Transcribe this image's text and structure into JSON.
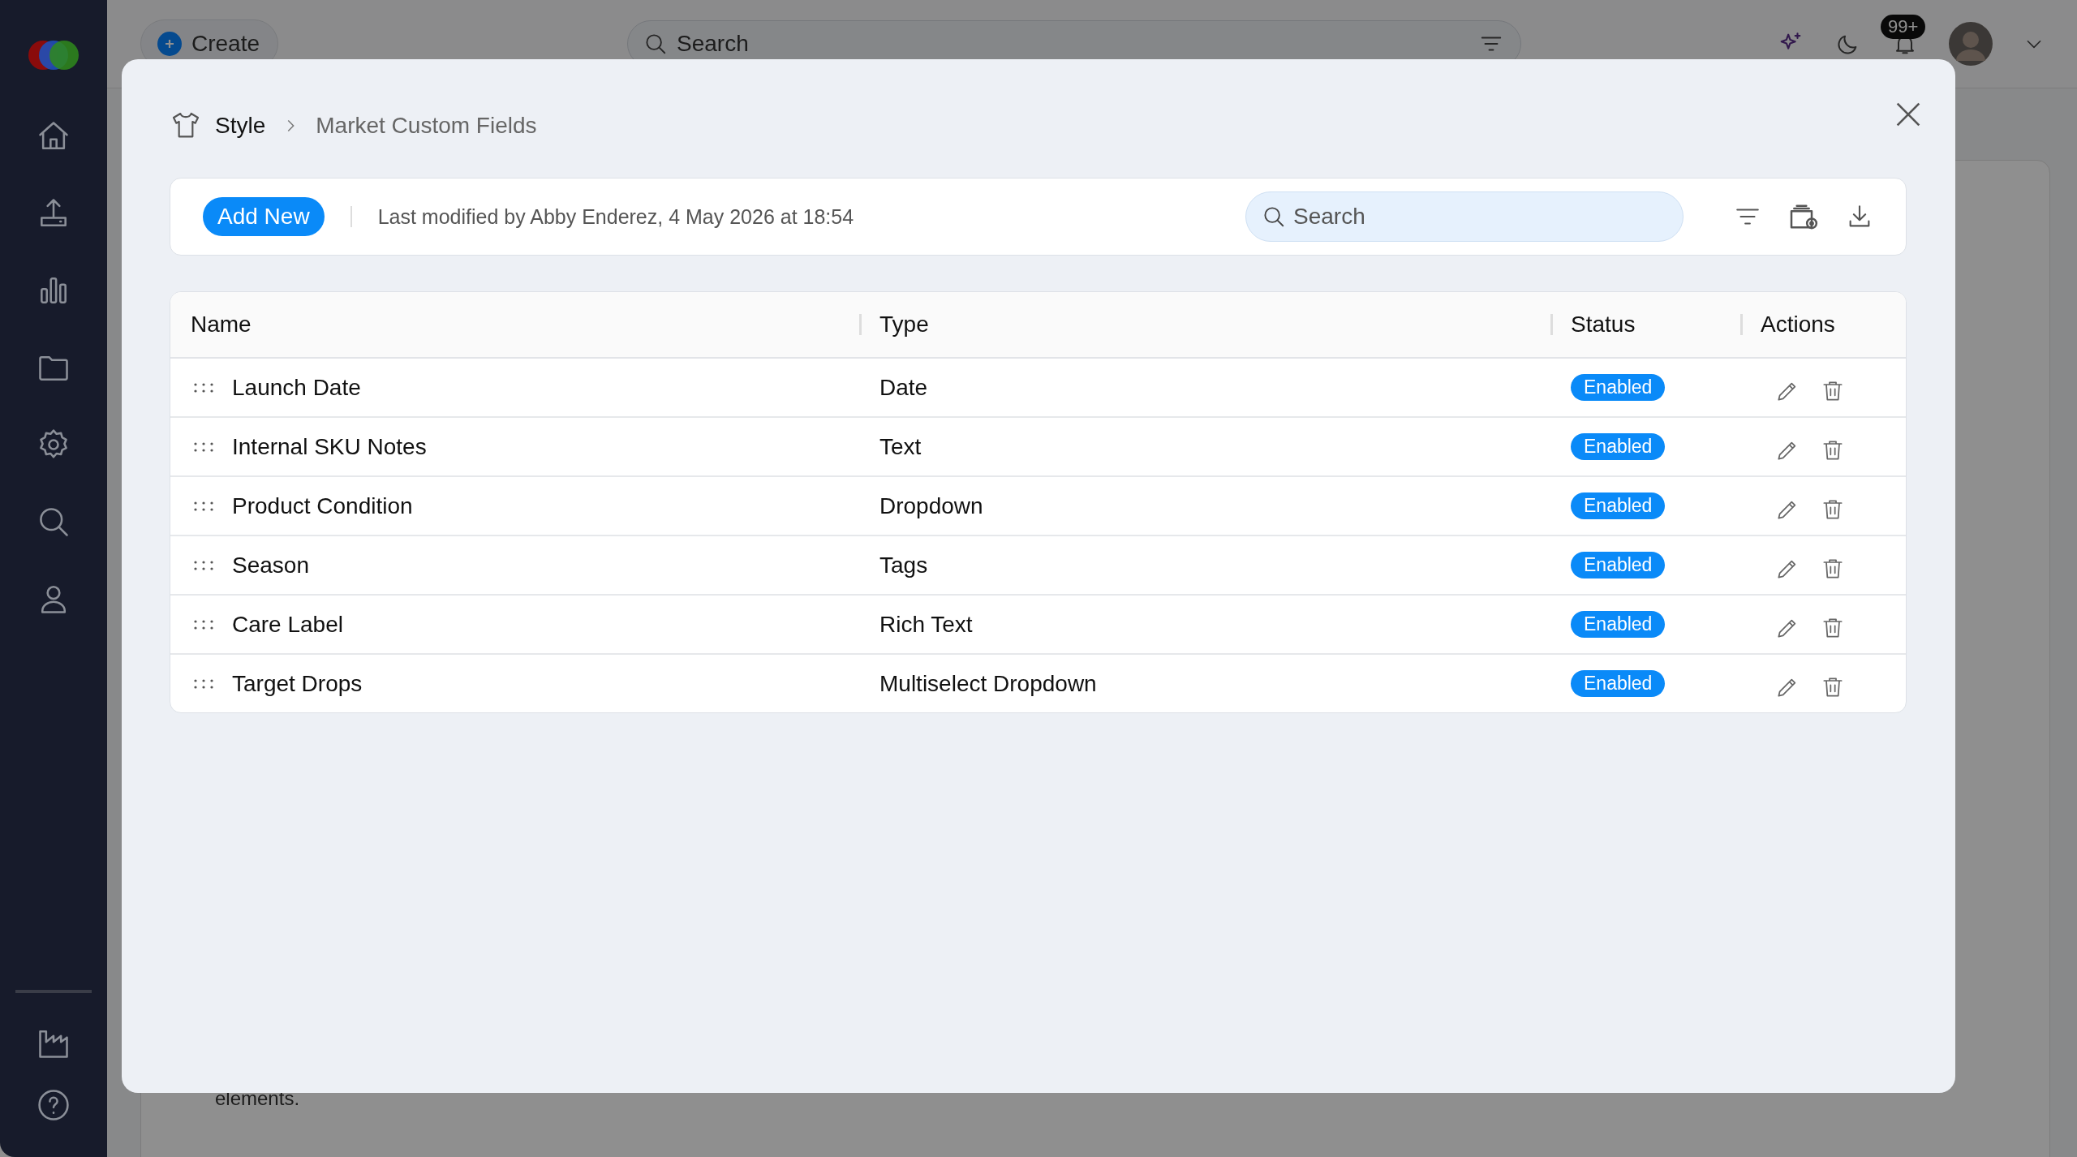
{
  "app": {
    "create_button": "Create",
    "search": {
      "placeholder": "Search"
    },
    "notifications_badge": "99+",
    "background_text": "elements."
  },
  "modal": {
    "breadcrumb": [
      "Style",
      "Market Custom Fields"
    ],
    "toolbar": {
      "add_button": "Add New",
      "last_modified": "Last modified by Abby Enderez, 4 May 2026 at 18:54",
      "search": {
        "placeholder": "Search"
      }
    },
    "table": {
      "columns": [
        "Name",
        "Type",
        "Status",
        "Actions"
      ],
      "rows": [
        {
          "name": "Launch Date",
          "type": "Date",
          "status": "Enabled"
        },
        {
          "name": "Internal SKU Notes",
          "type": "Text",
          "status": "Enabled"
        },
        {
          "name": "Product Condition",
          "type": "Dropdown",
          "status": "Enabled"
        },
        {
          "name": "Season",
          "type": "Tags",
          "status": "Enabled"
        },
        {
          "name": "Care Label",
          "type": "Rich Text",
          "status": "Enabled"
        },
        {
          "name": "Target Drops",
          "type": "Multiselect Dropdown",
          "status": "Enabled"
        }
      ]
    }
  }
}
